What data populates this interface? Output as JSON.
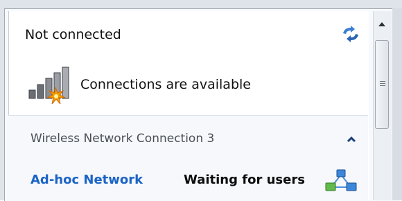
{
  "status": {
    "title": "Not connected",
    "message": "Connections are available"
  },
  "connection": {
    "name": "Wireless Network Connection 3",
    "network": {
      "name": "Ad-hoc Network",
      "status": "Waiting for users"
    }
  },
  "icons": {
    "refresh": "refresh-icon",
    "signal": "wireless-signal-icon",
    "collapse": "chevron-up-icon",
    "adhoc": "adhoc-network-icon",
    "scroll_up": "scroll-up-arrow-icon"
  },
  "colors": {
    "link": "#1a63c6",
    "group_background": "#f6f8fb",
    "signal_burst": "#f5a000"
  }
}
